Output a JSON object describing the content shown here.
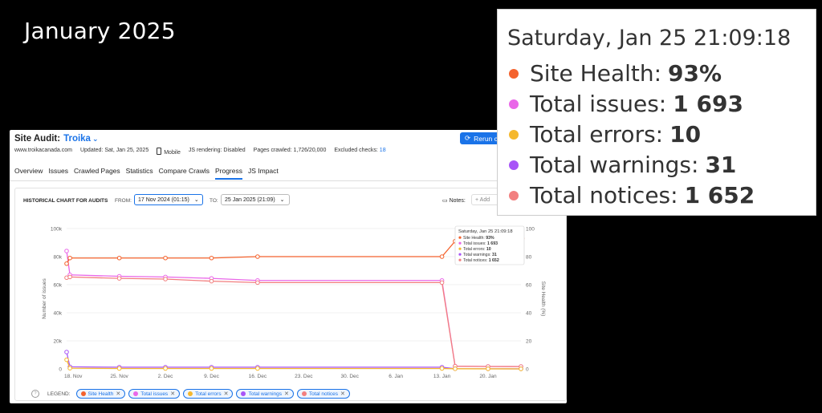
{
  "caption": "January 2025",
  "header": {
    "title": "Site Audit:",
    "project": "Troika",
    "rerun_label": "Rerun ca",
    "domain": "www.troikacanada.com",
    "updated": "Updated: Sat, Jan 25, 2025",
    "device": "Mobile",
    "js_rendering": "JS rendering: Disabled",
    "pages_crawled": "Pages crawled: 1,726/20,000",
    "excluded_label": "Excluded checks:",
    "excluded_value": "18"
  },
  "tabs": [
    {
      "label": "Overview"
    },
    {
      "label": "Issues"
    },
    {
      "label": "Crawled Pages"
    },
    {
      "label": "Statistics"
    },
    {
      "label": "Compare Crawls"
    },
    {
      "label": "Progress"
    },
    {
      "label": "JS Impact"
    }
  ],
  "card": {
    "title": "HISTORICAL CHART FOR AUDITS",
    "from_label": "FROM:",
    "from_value": "17 Nov 2024 (01:15)",
    "to_label": "TO:",
    "to_value": "25 Jan 2025 (21:09)",
    "notes_label": "Notes:",
    "add_label": "+ Add"
  },
  "legend": {
    "label": "LEGEND:",
    "items": [
      {
        "name": "Site Health",
        "color": "#f4622d"
      },
      {
        "name": "Total issues",
        "color": "#e967e8"
      },
      {
        "name": "Total errors",
        "color": "#f5b82e"
      },
      {
        "name": "Total warnings",
        "color": "#a855f7"
      },
      {
        "name": "Total notices",
        "color": "#f27f7f"
      }
    ]
  },
  "tooltip": {
    "date": "Saturday, Jan 25 21:09:18",
    "rows": [
      {
        "label": "Site Health:",
        "value": "93%",
        "color": "#f4622d"
      },
      {
        "label": "Total issues:",
        "value": "1 693",
        "color": "#e967e8"
      },
      {
        "label": "Total errors:",
        "value": "10",
        "color": "#f5b82e"
      },
      {
        "label": "Total warnings:",
        "value": "31",
        "color": "#a855f7"
      },
      {
        "label": "Total notices:",
        "value": "1 652",
        "color": "#f27f7f"
      }
    ]
  },
  "chart_data": {
    "type": "line",
    "xlabels": [
      "18. Nov",
      "25. Nov",
      "2. Dec",
      "9. Dec",
      "16. Dec",
      "23. Dec",
      "30. Dec",
      "6. Jan",
      "13. Jan",
      "20. Jan"
    ],
    "xlabel_days": [
      1,
      8,
      15,
      22,
      29,
      36,
      43,
      50,
      57,
      64
    ],
    "ylabel_left": "Number of issues",
    "ylabel_right": "Site Health (%)",
    "yticks_left": [
      "0",
      "20k",
      "40k",
      "60k",
      "80k",
      "100k"
    ],
    "yticks_right": [
      "0",
      "20",
      "40",
      "60",
      "80",
      "100"
    ],
    "ylim_left": [
      0,
      100000
    ],
    "ylim_right": [
      0,
      100
    ],
    "x_days": [
      0,
      0.5,
      8,
      15,
      22,
      29,
      57,
      59,
      64,
      69
    ],
    "series": [
      {
        "name": "Site Health",
        "axis": "right",
        "color": "#f4622d",
        "values": [
          75,
          79,
          79,
          79,
          79,
          80,
          80,
          91,
          92,
          93
        ]
      },
      {
        "name": "Total issues",
        "axis": "left",
        "color": "#e967e8",
        "values": [
          84000,
          67000,
          66000,
          65500,
          64500,
          63000,
          63000,
          2000,
          1700,
          1693
        ]
      },
      {
        "name": "Total errors",
        "axis": "left",
        "color": "#f5b82e",
        "values": [
          6500,
          500,
          300,
          300,
          300,
          300,
          300,
          100,
          50,
          10
        ]
      },
      {
        "name": "Total warnings",
        "axis": "left",
        "color": "#a855f7",
        "values": [
          12000,
          1500,
          1200,
          1200,
          1200,
          1200,
          1200,
          100,
          60,
          31
        ]
      },
      {
        "name": "Total notices",
        "axis": "left",
        "color": "#f27f7f",
        "values": [
          65000,
          65500,
          64500,
          64000,
          62500,
          61500,
          61500,
          1900,
          1700,
          1652
        ]
      }
    ]
  }
}
